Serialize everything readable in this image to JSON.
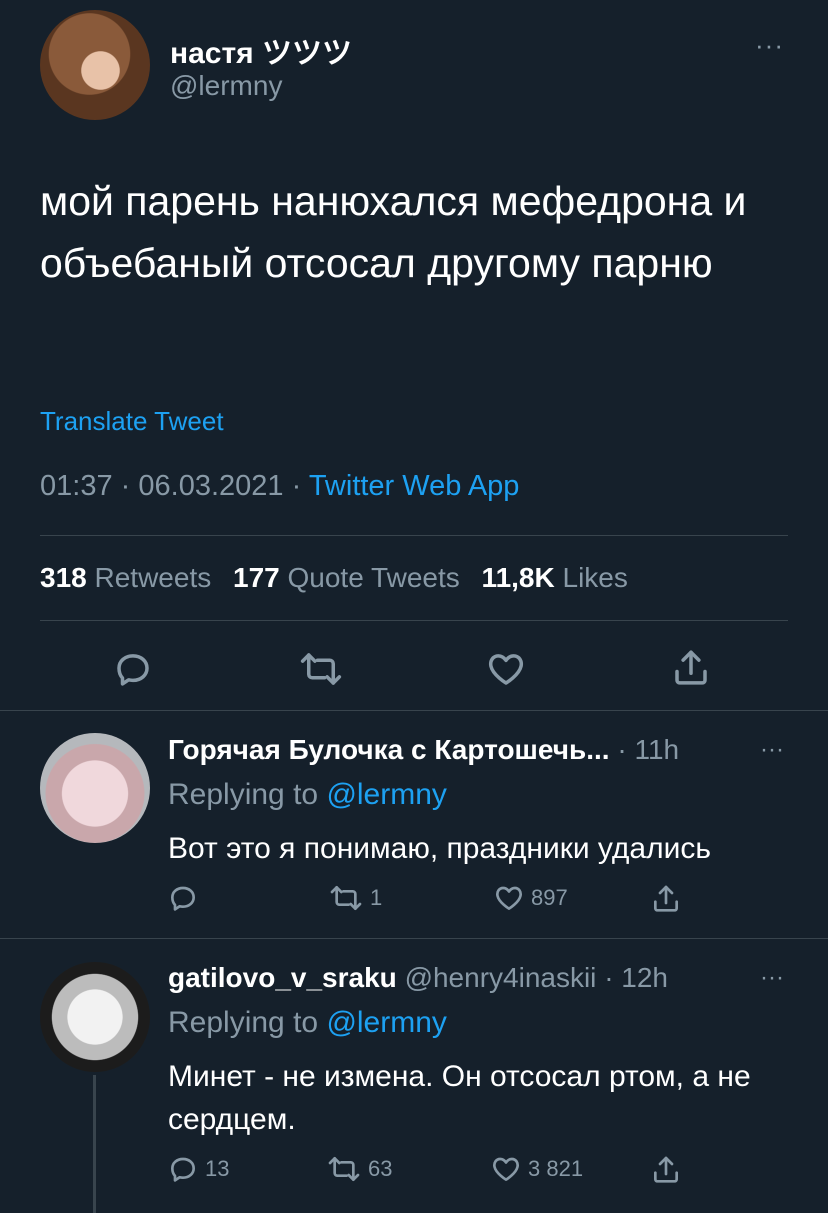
{
  "main_tweet": {
    "author_name": "настя ツツツ",
    "author_handle": "@lermny",
    "more": "···",
    "text": "мой парень нанюхался мефедрона и объебаный отсосал другому парню",
    "translate": "Translate Tweet",
    "time": "01:37",
    "date": "06.03.2021",
    "sep": "·",
    "app": "Twitter Web App",
    "stats": {
      "retweets_count": "318",
      "retweets_label": "Retweets",
      "quotes_count": "177",
      "quotes_label": "Quote Tweets",
      "likes_count": "11,8K",
      "likes_label": "Likes"
    },
    "actions": {
      "reply": "reply-icon",
      "retweet": "retweet-icon",
      "like": "heart-icon",
      "share": "share-icon"
    }
  },
  "replies": [
    {
      "name": "Горячая Булочка с Картошечь...",
      "handle": "",
      "time": "· 11h",
      "more": "···",
      "replying_prefix": "Replying to",
      "replying_to": "@lermny",
      "text": "Вот это я понимаю, праздники удались",
      "reply_count": "",
      "retweet_count": "1",
      "like_count": "897"
    },
    {
      "name": "gatilovo_v_sraku",
      "handle": "@henry4inaskii",
      "time": "· 12h",
      "more": "···",
      "replying_prefix": "Replying to",
      "replying_to": "@lermny",
      "text": "Минет - не измена. Он отсосал ртом, а не сердцем.",
      "reply_count": "13",
      "retweet_count": "63",
      "like_count": "3 821"
    }
  ],
  "colors": {
    "background": "#15202b",
    "text": "#ffffff",
    "muted": "#8899a6",
    "accent": "#1da1f2",
    "divider": "#38444d"
  }
}
